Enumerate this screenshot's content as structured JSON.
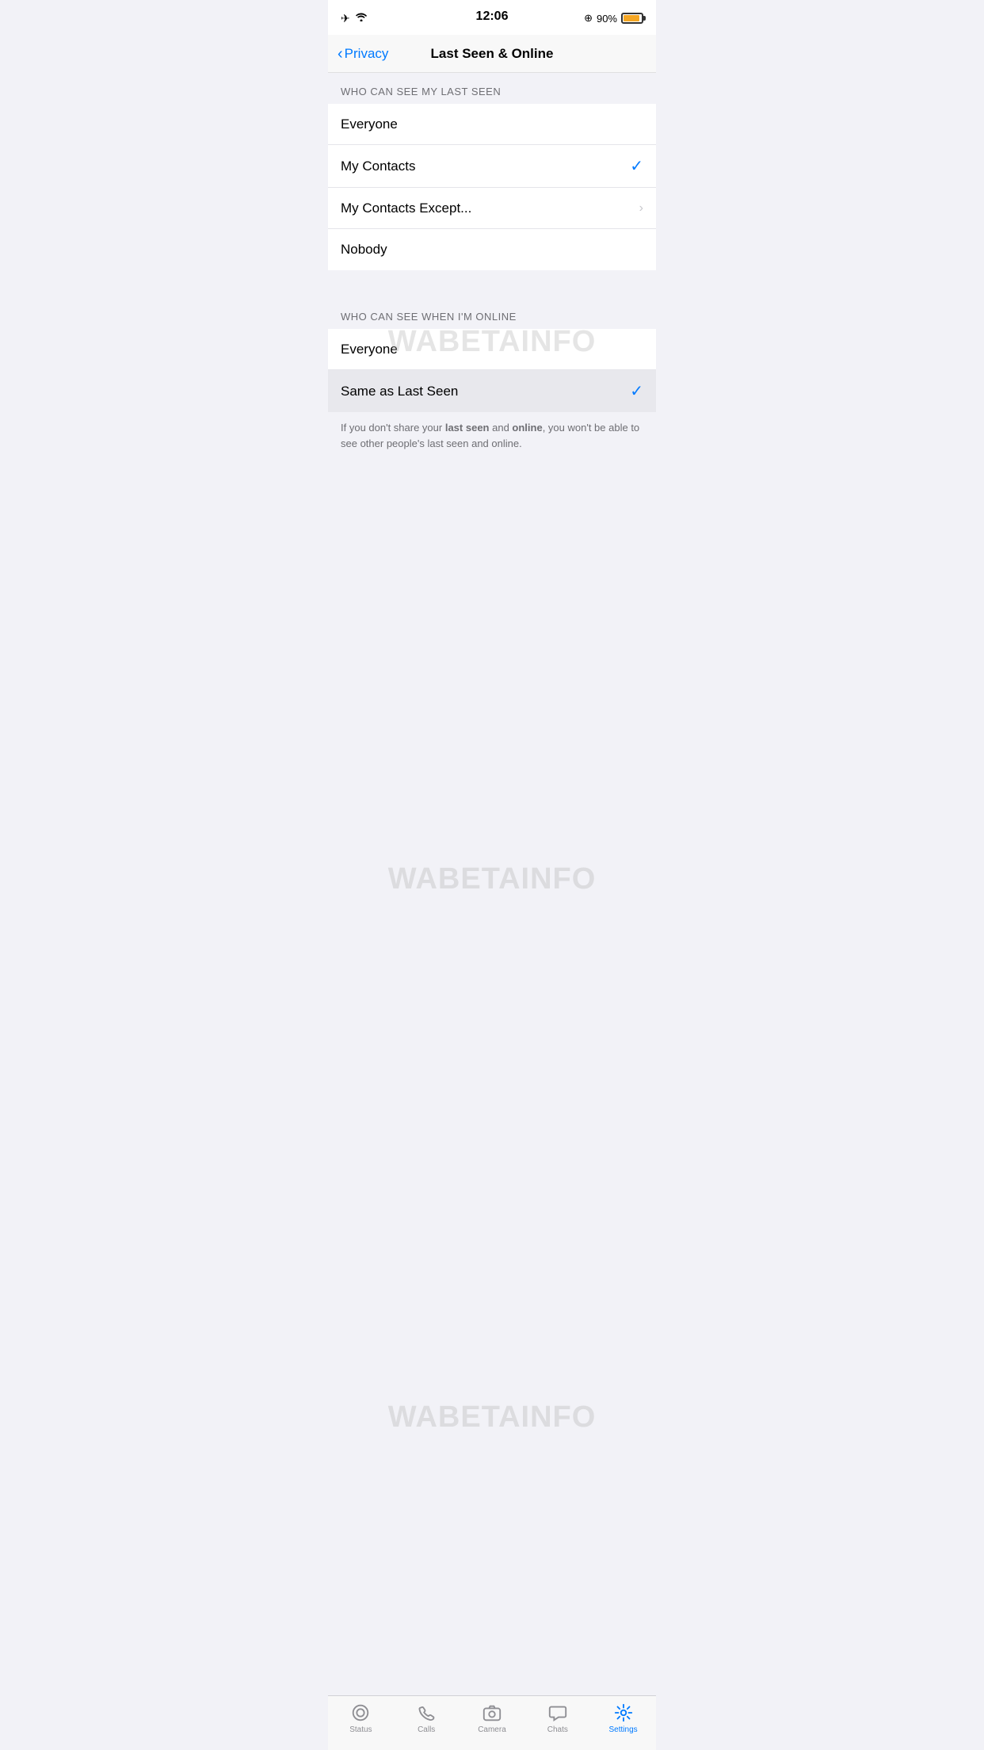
{
  "statusBar": {
    "time": "12:06",
    "battery": "90%",
    "batteryColor": "#f5a623"
  },
  "navBar": {
    "backLabel": "Privacy",
    "title": "Last Seen & Online"
  },
  "watermarkText": "WABetaInfo",
  "lastSeenSection": {
    "header": "WHO CAN SEE MY LAST SEEN",
    "options": [
      {
        "label": "Everyone",
        "selected": false,
        "hasChevron": false
      },
      {
        "label": "My Contacts",
        "selected": true,
        "hasChevron": false
      },
      {
        "label": "My Contacts Except...",
        "selected": false,
        "hasChevron": true
      },
      {
        "label": "Nobody",
        "selected": false,
        "hasChevron": false
      }
    ]
  },
  "onlineSection": {
    "header": "WHO CAN SEE WHEN I'M ONLINE",
    "options": [
      {
        "label": "Everyone",
        "selected": false,
        "hasChevron": false
      },
      {
        "label": "Same as Last Seen",
        "selected": true,
        "hasChevron": false,
        "highlighted": true
      }
    ]
  },
  "infoText": {
    "prefix": "If you don't share your ",
    "bold1": "last seen",
    "middle": " and ",
    "bold2": "online",
    "suffix": ", you won't be able to see other people's last seen and online."
  },
  "tabBar": {
    "items": [
      {
        "id": "status",
        "label": "Status",
        "active": false
      },
      {
        "id": "calls",
        "label": "Calls",
        "active": false
      },
      {
        "id": "camera",
        "label": "Camera",
        "active": false
      },
      {
        "id": "chats",
        "label": "Chats",
        "active": false
      },
      {
        "id": "settings",
        "label": "Settings",
        "active": true
      }
    ]
  }
}
